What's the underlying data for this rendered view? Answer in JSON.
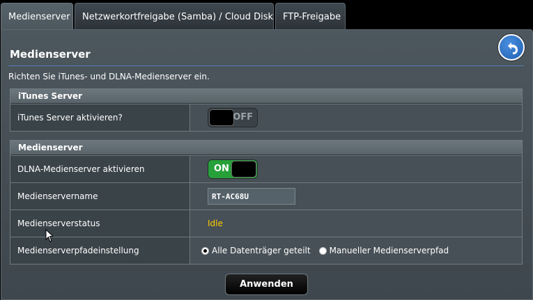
{
  "tabs": [
    {
      "label": "Medienserver",
      "active": true
    },
    {
      "label": "Netzwerkortfreigabe (Samba) / Cloud Disk",
      "active": false
    },
    {
      "label": "FTP-Freigabe",
      "active": false
    }
  ],
  "page": {
    "title": "Medienserver",
    "subtitle": "Richten Sie iTunes- und DLNA-Medienserver ein."
  },
  "itunes": {
    "heading": "iTunes Server",
    "enable_label": "iTunes Server aktivieren?",
    "toggle_text": "OFF"
  },
  "media": {
    "heading": "Medienserver",
    "dlna_label": "DLNA-Medienserver aktivieren",
    "dlna_toggle_text": "ON",
    "name_label": "Medienservername",
    "name_value": "RT-AC68U",
    "status_label": "Medienserverstatus",
    "status_value": "Idle",
    "path_label": "Medienserverpfadeinstellung",
    "path_option_1": "Alle Datenträger geteilt",
    "path_option_2": "Manueller Medienserverpfad"
  },
  "apply_label": "Anwenden",
  "colors": {
    "status": "#ffcc00",
    "toggle_on": "#27a03a",
    "back_button": "#1f5fb0"
  }
}
